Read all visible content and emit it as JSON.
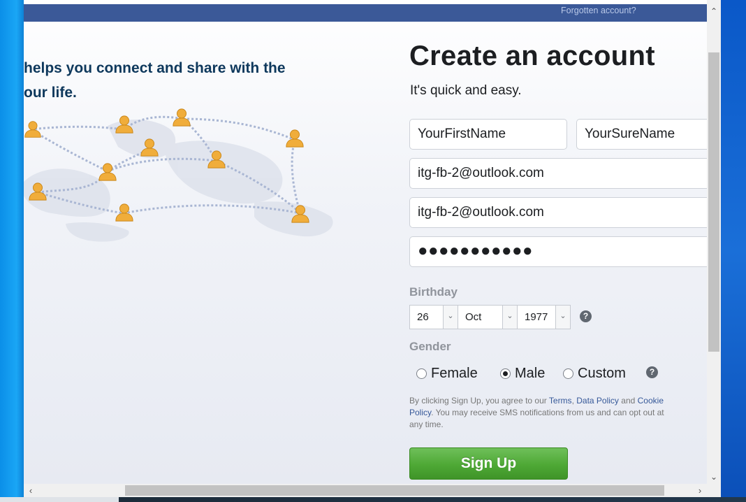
{
  "header": {
    "forgotten_link": "Forgotten account?"
  },
  "left": {
    "tagline_line1": "helps you connect and share with the",
    "tagline_line2": "our life."
  },
  "form": {
    "title": "Create an account",
    "subtitle": "It's quick and easy.",
    "first_name_value": "YourFirstName",
    "last_name_value": "YourSureName",
    "email_value": "itg-fb-2@outlook.com",
    "email_confirm_value": "itg-fb-2@outlook.com",
    "password_mask": "●●●●●●●●●●●",
    "birthday_label": "Birthday",
    "birthday_day": "26",
    "birthday_month": "Oct",
    "birthday_year": "1977",
    "gender_label": "Gender",
    "gender_options": [
      "Female",
      "Male",
      "Custom"
    ],
    "gender_selected": "Male",
    "help_glyph": "?",
    "terms_prefix": "By clicking Sign Up, you agree to our ",
    "terms_link": "Terms",
    "terms_sep": ", ",
    "data_policy_link": "Data Policy",
    "terms_and": " and ",
    "cookie_policy_link": "Cookie Policy",
    "terms_suffix": ". You may receive SMS notifications from us and can opt out at any time.",
    "signup_label": "Sign Up"
  },
  "icons": {
    "select_arrow": "chevron-down-icon",
    "help": "help-circle-icon",
    "people": "person-icon"
  },
  "colors": {
    "brand_blue": "#3b5998",
    "signup_green": "#4ea835",
    "tagline": "#0e385c",
    "person_orange": "#f0ad3b"
  }
}
